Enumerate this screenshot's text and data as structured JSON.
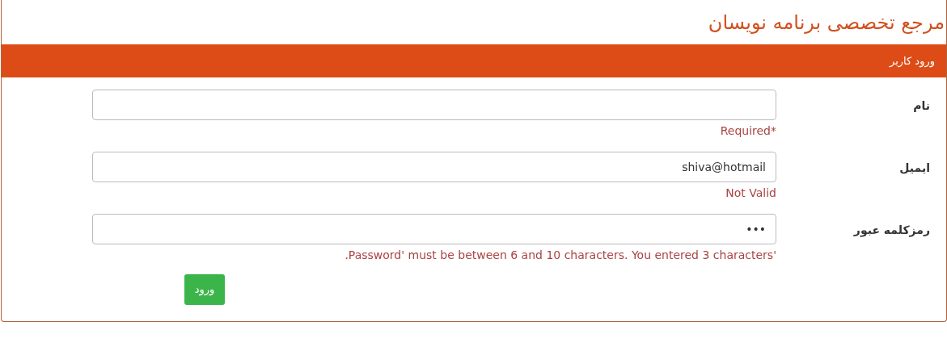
{
  "site_title": "مرجع تخصصی برنامه نویسان",
  "panel": {
    "heading": "ورود کاربر"
  },
  "fields": [
    {
      "label": "نام",
      "error": "*Required"
    },
    {
      "label": "ایمیل",
      "value": "shiva@hotmail",
      "error": "Not Valid"
    },
    {
      "label": "رمزکلمه عبور",
      "value": "•••",
      "error": "'Password' must be between 6 and 10 characters. You entered 3 characters."
    }
  ],
  "submit_button": "ورود"
}
